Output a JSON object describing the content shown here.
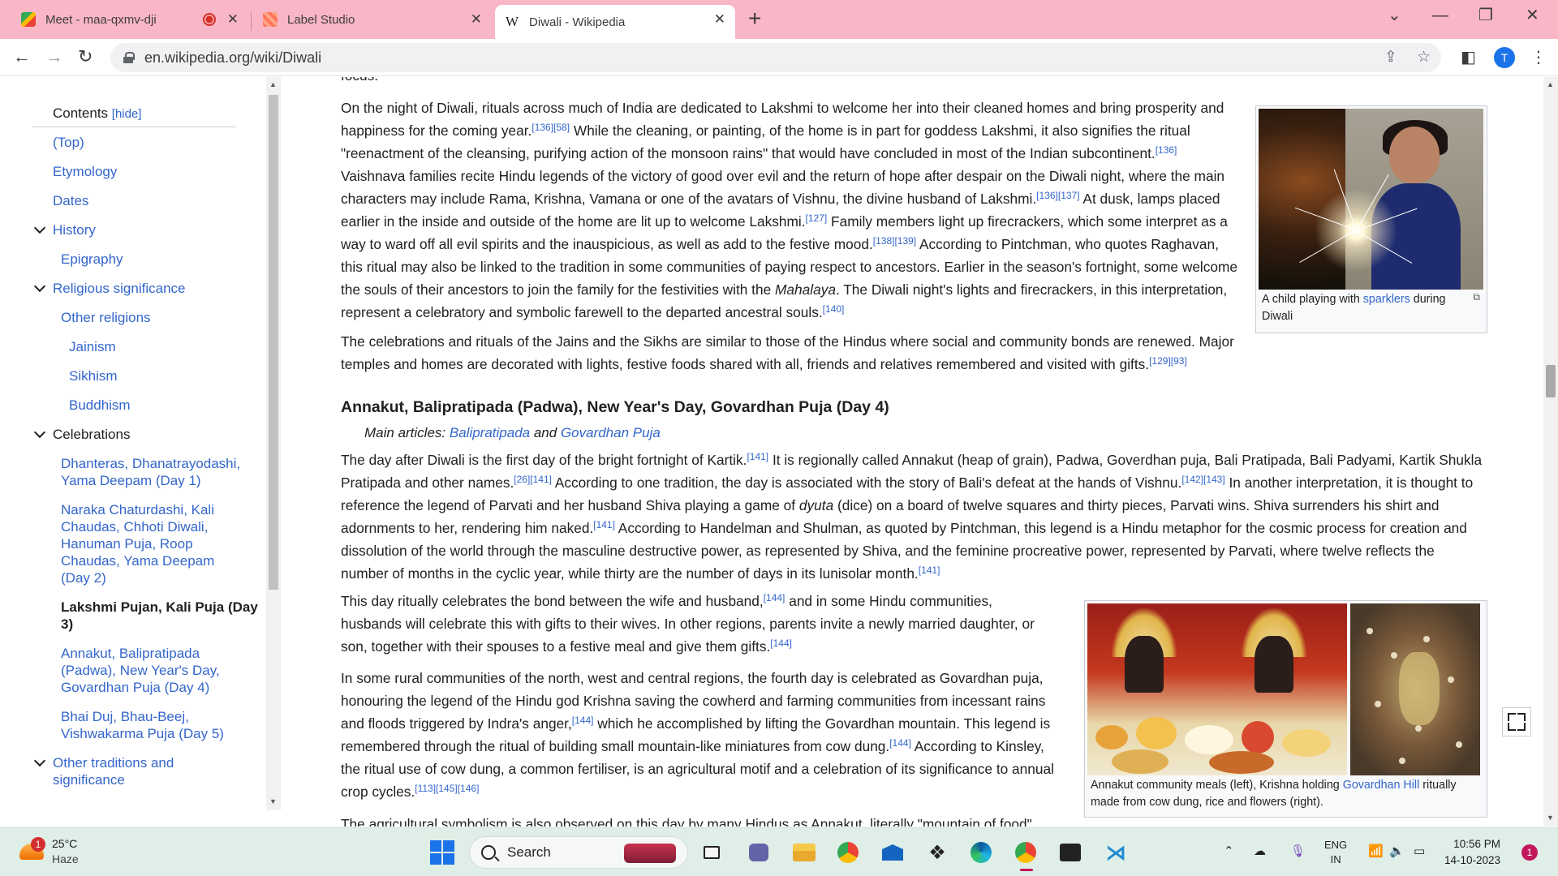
{
  "browser": {
    "tabs": [
      {
        "title": "Meet - maa-qxmv-dji"
      },
      {
        "title": "Label Studio"
      },
      {
        "title": "Diwali - Wikipedia"
      }
    ],
    "new_tab": "+",
    "url": "en.wikipedia.org/wiki/Diwali",
    "profile_initial": "T"
  },
  "toc": {
    "title": "Contents",
    "hide_label": "[hide]",
    "items": [
      {
        "label": "(Top)"
      },
      {
        "label": "Etymology"
      },
      {
        "label": "Dates"
      },
      {
        "label": "History"
      },
      {
        "label": "Epigraphy"
      },
      {
        "label": "Religious significance"
      },
      {
        "label": "Other religions"
      },
      {
        "label": "Jainism"
      },
      {
        "label": "Sikhism"
      },
      {
        "label": "Buddhism"
      },
      {
        "label": "Celebrations"
      },
      {
        "label": "Dhanteras, Dhanatrayodashi, Yama Deepam (Day 1)"
      },
      {
        "label": "Naraka Chaturdashi, Kali Chaudas, Chhoti Diwali, Hanuman Puja, Roop Chaudas, Yama Deepam (Day 2)"
      },
      {
        "label": "Lakshmi Pujan, Kali Puja (Day 3)"
      },
      {
        "label": "Annakut, Balipratipada (Padwa), New Year's Day, Govardhan Puja (Day 4)"
      },
      {
        "label": "Bhai Duj, Bhau-Beej, Vishwakarma Puja (Day 5)"
      },
      {
        "label": "Other traditions and significance"
      }
    ]
  },
  "article": {
    "top_fragment": "focus.",
    "p1": {
      "t1": "On the night of Diwali, rituals across much of India are dedicated to Lakshmi to welcome her into their cleaned homes and bring prosperity and happiness for the coming year.",
      "r1": "[136][58]",
      "t2": " While the cleaning, or painting, of the home is in part for goddess Lakshmi, it also signifies the ritual \"reenactment of the cleansing, purifying action of the monsoon rains\" that would have concluded in most of the Indian subcontinent.",
      "r2": "[136]",
      "t3": " Vaishnava families recite Hindu legends of the victory of good over evil and the return of hope after despair on the Diwali night, where the main characters may include Rama, Krishna, Vamana or one of the avatars of Vishnu, the divine husband of Lakshmi.",
      "r3": "[136][137]",
      "t4": " At dusk, lamps placed earlier in the inside and outside of the home are lit up to welcome Lakshmi.",
      "r4": "[127]",
      "t5": " Family members light up firecrackers, which some interpret as a way to ward off all evil spirits and the inauspicious, as well as add to the festive mood.",
      "r5": "[138][139]",
      "t6": " According to Pintchman, who quotes Raghavan, this ritual may also be linked to the tradition in some communities of paying respect to ancestors. Earlier in the season's fortnight, some welcome the souls of their ancestors to join the family for the festivities with the ",
      "t6_italic": "Mahalaya",
      "t7": ". The Diwali night's lights and firecrackers, in this interpretation, represent a celebratory and symbolic farewell to the departed ancestral souls.",
      "r7": "[140]"
    },
    "p2": {
      "t1": "The celebrations and rituals of the Jains and the Sikhs are similar to those of the Hindus where social and community bonds are renewed. Major temples and homes are decorated with lights, festive foods shared with all, friends and relatives remembered and visited with gifts.",
      "r1": "[129][93]"
    },
    "heading": "Annakut, Balipratipada (Padwa), New Year's Day, Govardhan Puja (Day 4)",
    "hatnote": {
      "prefix": "Main articles: ",
      "link1": "Balipratipada",
      "and": " and ",
      "link2": "Govardhan Puja"
    },
    "p3": {
      "t1": "The day after Diwali is the first day of the bright fortnight of Kartik.",
      "r1": "[141]",
      "t2": " It is regionally called Annakut (heap of grain), Padwa, Goverdhan puja, Bali Pratipada, Bali Padyami, Kartik Shukla Pratipada and other names.",
      "r2": "[26][141]",
      "t3": " According to one tradition, the day is associated with the story of Bali's defeat at the hands of Vishnu.",
      "r3": "[142][143]",
      "t4": " In another interpretation, it is thought to reference the legend of Parvati and her husband Shiva playing a game of ",
      "t4_italic": "dyuta",
      "t5": " (dice) on a board of twelve squares and thirty pieces, Parvati wins. Shiva surrenders his shirt and adornments to her, rendering him naked.",
      "r5": "[141]",
      "t6": " According to Handelman and Shulman, as quoted by Pintchman, this legend is a Hindu metaphor for the cosmic process for creation and dissolution of the world through the masculine destructive power, as represented by Shiva, and the feminine procreative power, represented by Parvati, where twelve reflects the number of months in the cyclic year, while thirty are the number of days in its lunisolar month.",
      "r6": "[141]"
    },
    "p4": {
      "t1": "This day ritually celebrates the bond between the wife and husband,",
      "r1": "[144]",
      "t2": " and in some Hindu communities, husbands will celebrate this with gifts to their wives. In other regions, parents invite a newly married daughter, or son, together with their spouses to a festive meal and give them gifts.",
      "r2": "[144]"
    },
    "p5": {
      "t1": "In some rural communities of the north, west and central regions, the fourth day is celebrated as Govardhan puja, honouring the legend of the Hindu god Krishna saving the cowherd and farming communities from incessant rains and floods triggered by Indra's anger,",
      "r1": "[144]",
      "t2": " which he accomplished by lifting the Govardhan mountain. This legend is remembered through the ritual of building small mountain-like miniatures from cow dung.",
      "r2": "[144]",
      "t3": " According to Kinsley, the ritual use of cow dung, a common fertiliser, is an agricultural motif and a celebration of its significance to annual crop cycles.",
      "r3": "[113][145][146]"
    },
    "p6_fragment": "The agricultural symbolism is also observed on this day by many Hindus as Annakut, literally \"mountain of food\".",
    "figure1": {
      "cap1": "A child playing with ",
      "link": "sparklers",
      "cap2": " during Diwali"
    },
    "figure2": {
      "cap1": "Annakut community meals (left), Krishna holding ",
      "link": "Govardhan Hill",
      "cap2": " ritually made from cow dung, rice and flowers (right)."
    }
  },
  "taskbar": {
    "weather_temp": "25°C",
    "weather_desc": "Haze",
    "weather_badge": "1",
    "search_label": "Search",
    "lang1": "ENG",
    "lang2": "IN",
    "time": "10:56 PM",
    "date": "14-10-2023",
    "notif_count": "1"
  }
}
